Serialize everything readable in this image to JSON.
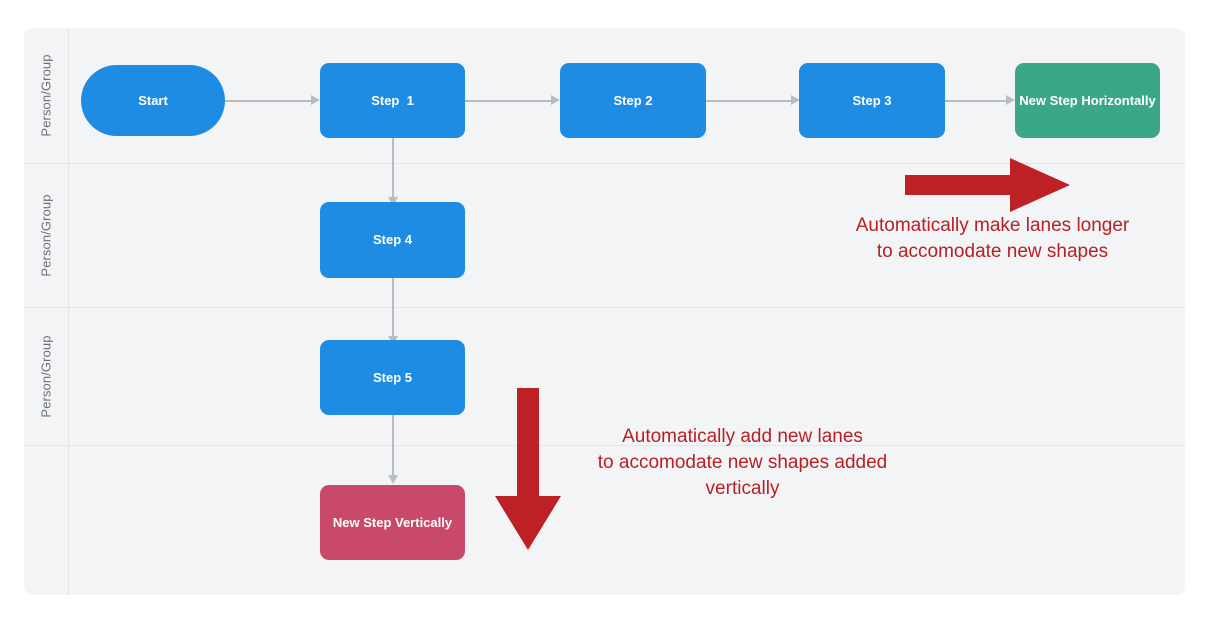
{
  "diagram": {
    "title": "Swimlane flowchart with auto-expanding lanes",
    "colors": {
      "blue": "#1f8ce3",
      "green": "#3aa887",
      "pink": "#c9496b",
      "annotation_red": "#b72025",
      "lane_background": "#f3f4f6",
      "lane_separator": "#e3e5e8",
      "connector": "#b9bdc2"
    },
    "lanes": [
      {
        "label": "Person/Group"
      },
      {
        "label": "Person/Group"
      },
      {
        "label": "Person/Group"
      },
      {
        "label": ""
      }
    ],
    "nodes": [
      {
        "id": "start",
        "label": "Start",
        "shape": "pill",
        "color": "blue",
        "lane": 1
      },
      {
        "id": "step1",
        "label": "Step  1",
        "shape": "rect",
        "color": "blue",
        "lane": 1
      },
      {
        "id": "step2",
        "label": "Step 2",
        "shape": "rect",
        "color": "blue",
        "lane": 1
      },
      {
        "id": "step3",
        "label": "Step 3",
        "shape": "rect",
        "color": "blue",
        "lane": 1
      },
      {
        "id": "newhoriz",
        "label": "New Step Horizontally",
        "shape": "rect",
        "color": "green",
        "lane": 1
      },
      {
        "id": "step4",
        "label": "Step 4",
        "shape": "rect",
        "color": "blue",
        "lane": 2
      },
      {
        "id": "step5",
        "label": "Step 5",
        "shape": "rect",
        "color": "blue",
        "lane": 3
      },
      {
        "id": "newvert",
        "label": "New Step Vertically",
        "shape": "rect",
        "color": "pink",
        "lane": 4
      }
    ],
    "annotations": [
      {
        "id": "horizontal-note",
        "text": "Automatically make lanes longer\nto accomodate new shapes",
        "arrow": "right"
      },
      {
        "id": "vertical-note",
        "text": "Automatically add new lanes\nto accomodate new shapes added\nvertically",
        "arrow": "down"
      }
    ]
  }
}
